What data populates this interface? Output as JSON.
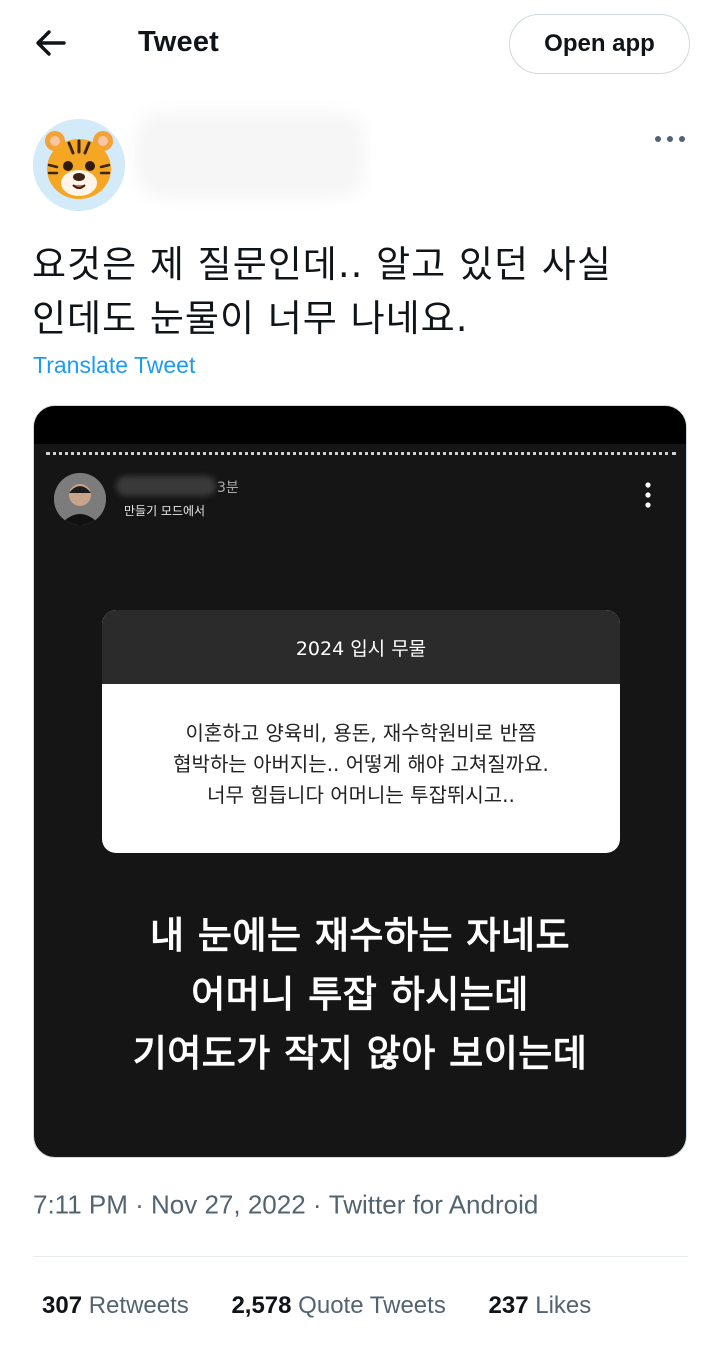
{
  "header": {
    "title": "Tweet",
    "open_app_label": "Open app"
  },
  "tweet": {
    "text_line1": "요것은 제 질문인데.. 알고 있던 사실",
    "text_line2": "인데도 눈물이 너무 나네요.",
    "translate_label": "Translate Tweet"
  },
  "media": {
    "story": {
      "time": "3분",
      "mode_label": "만들기 모드에서",
      "question_title": "2024 입시 무물",
      "question_lines": [
        "이혼하고 양육비, 용돈, 재수학원비로 반쯤",
        "협박하는 아버지는.. 어떻게 해야 고쳐질까요.",
        "너무 힘듭니다 어머니는 투잡뛰시고.."
      ],
      "answer_lines": [
        "내 눈에는 재수하는 자네도",
        "어머니 투잡 하시는데",
        "기여도가 작지 않아 보이는데"
      ]
    }
  },
  "meta": {
    "time": "7:11 PM",
    "sep1": " · ",
    "date": "Nov 27, 2022",
    "sep2": " · ",
    "source": "Twitter for Android"
  },
  "stats": {
    "retweets_count": "307",
    "retweets_label": "Retweets",
    "quotes_count": "2,578",
    "quotes_label": "Quote Tweets",
    "likes_count": "237",
    "likes_label": "Likes"
  },
  "icons": {
    "back": "arrow-left-icon",
    "more": "more-horizontal-icon",
    "story_more": "more-vertical-icon",
    "avatar": "tiger-face-emoji"
  },
  "colors": {
    "accent": "#1d9bf0",
    "text": "#0f1419",
    "muted": "#536471",
    "story_bg": "#151515"
  }
}
